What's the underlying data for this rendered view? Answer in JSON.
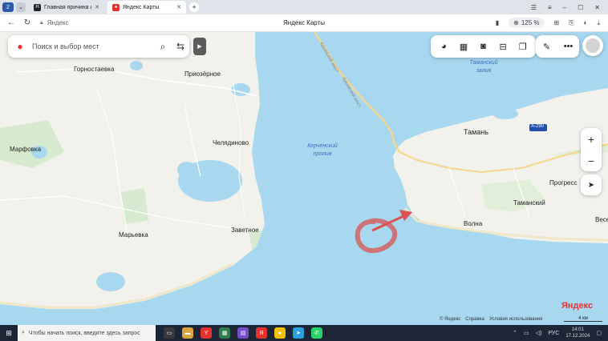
{
  "browser": {
    "tabs": [
      {
        "title": "Главная причина крушени",
        "favicon": "H",
        "favicon_color": "#222222",
        "active": false
      },
      {
        "title": "Яндекс Карты",
        "favicon": "pin",
        "favicon_color": "#e8322f",
        "active": true
      }
    ],
    "address": {
      "host": "Яндекс",
      "page_title": "Яндекс Карты",
      "zoom": "125 %"
    }
  },
  "map": {
    "search_placeholder": "Поиск и выбор мест",
    "places": [
      {
        "id": "gornostaevka",
        "name": "Горностаевка"
      },
      {
        "id": "priozernoe",
        "name": "Приозёрное"
      },
      {
        "id": "marfovka",
        "name": "Марфовка"
      },
      {
        "id": "chelyadinovo",
        "name": "Челядиново"
      },
      {
        "id": "maryevka",
        "name": "Марьевка"
      },
      {
        "id": "zavetnoe",
        "name": "Заветное"
      },
      {
        "id": "taman",
        "name": "Тамань"
      },
      {
        "id": "progress",
        "name": "Прогресс"
      },
      {
        "id": "tamanskiy",
        "name": "Таманский"
      },
      {
        "id": "volna",
        "name": "Волна"
      },
      {
        "id": "vese",
        "name": "Весе"
      }
    ],
    "water": [
      {
        "id": "kerch-strait",
        "name": "Керченский\nпролив"
      },
      {
        "id": "taman-bay",
        "name": "Таманский\nзалив"
      }
    ],
    "roads": [
      {
        "id": "crimean-bridge",
        "name": "Крымский мост"
      },
      {
        "id": "a290",
        "name": "А-290"
      }
    ],
    "brand": "Яндекс",
    "footer": {
      "copyright": "© Яндекс",
      "help": "Справка",
      "terms": "Условия использования"
    },
    "scale": "4 км",
    "annotation_color": "#d9534f"
  },
  "taskbar": {
    "search_placeholder": "Чтобы начать поиск, введите здесь запрос",
    "lang": "РУС",
    "time": "14:01",
    "date": "17.12.2024"
  }
}
